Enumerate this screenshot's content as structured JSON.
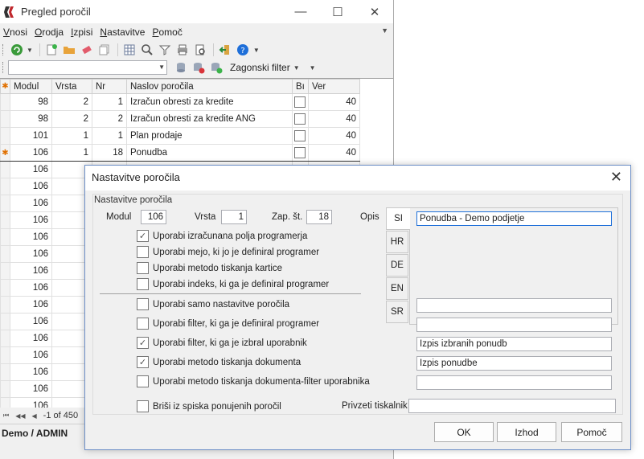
{
  "main_window": {
    "title": "Pregled poročil",
    "controls": {
      "minimize": "—",
      "maximize": "☐",
      "close": "✕"
    },
    "menu": [
      {
        "label": "Vnosi"
      },
      {
        "label": "Orodja"
      },
      {
        "label": "Izpisi"
      },
      {
        "label": "Nastavitve"
      },
      {
        "label": "Pomoč"
      }
    ],
    "filter_label": "Zagonski filter",
    "grid": {
      "columns": [
        "Modul",
        "Vrsta",
        "Nr",
        "Naslov poročila",
        "Bı",
        "Ver"
      ],
      "rows": [
        {
          "modul": "98",
          "vrsta": "2",
          "nr": "1",
          "naslov": "Izračun obresti za kredite",
          "ver": "40"
        },
        {
          "modul": "98",
          "vrsta": "2",
          "nr": "2",
          "naslov": "Izračun obresti za kredite ANG",
          "ver": "40"
        },
        {
          "modul": "101",
          "vrsta": "1",
          "nr": "1",
          "naslov": "Plan prodaje",
          "ver": "40"
        },
        {
          "modul": "106",
          "vrsta": "1",
          "nr": "18",
          "naslov": "Ponudba",
          "ver": "40"
        },
        {
          "modul": "106"
        },
        {
          "modul": "106"
        },
        {
          "modul": "106"
        },
        {
          "modul": "106"
        },
        {
          "modul": "106"
        },
        {
          "modul": "106"
        },
        {
          "modul": "106"
        },
        {
          "modul": "106"
        },
        {
          "modul": "106"
        },
        {
          "modul": "106"
        },
        {
          "modul": "106"
        },
        {
          "modul": "106"
        },
        {
          "modul": "106"
        },
        {
          "modul": "106"
        },
        {
          "modul": "106"
        }
      ]
    },
    "record_nav": "-1 of 450",
    "status": "Demo / ADMIN"
  },
  "dialog": {
    "title": "Nastavitve poročila",
    "close": "✕",
    "group_title": "Nastavitve poročila",
    "modul_label": "Modul",
    "modul_value": "106",
    "vrsta_label": "Vrsta",
    "vrsta_value": "1",
    "zap_label": "Zap. št.",
    "zap_value": "18",
    "opis_label": "Opis",
    "checkboxes": [
      {
        "label": "Uporabi izračunana polja programerja",
        "checked": true
      },
      {
        "label": "Uporabi mejo, ki jo je definiral programer",
        "checked": false
      },
      {
        "label": "Uporabi metodo tiskanja kartice",
        "checked": false
      },
      {
        "label": "Uporabi indeks, ki ga je definiral programer",
        "checked": false
      },
      {
        "label": "Uporabi samo nastavitve poročila",
        "checked": false
      },
      {
        "label": "Uporabi filter, ki ga je definiral programer",
        "checked": false
      },
      {
        "label": "Uporabi filter, ki ga je izbral uporabnik",
        "checked": true
      },
      {
        "label": "Uporabi metodo tiskanja dokumenta",
        "checked": true
      },
      {
        "label": "Uporabi metodo tiskanja dokumenta-filter uporabnika",
        "checked": false
      }
    ],
    "delete_label": "Briši iz spiska ponujenih poročil",
    "tabs": [
      "SI",
      "HR",
      "DE",
      "EN",
      "SR"
    ],
    "opis_value": "Ponudba - Demo podjetje",
    "right_fields": [
      "",
      "",
      "Izpis izbranih ponudb",
      "Izpis ponudbe",
      ""
    ],
    "printer_label": "Privzeti tiskalnik",
    "printer_value": "",
    "buttons": {
      "ok": "OK",
      "izhod": "Izhod",
      "pomoc": "Pomoč"
    }
  },
  "colors": {
    "accent": "#1e6fd9",
    "dialog_border": "#6d8fc7",
    "indicator": "#e07000"
  }
}
